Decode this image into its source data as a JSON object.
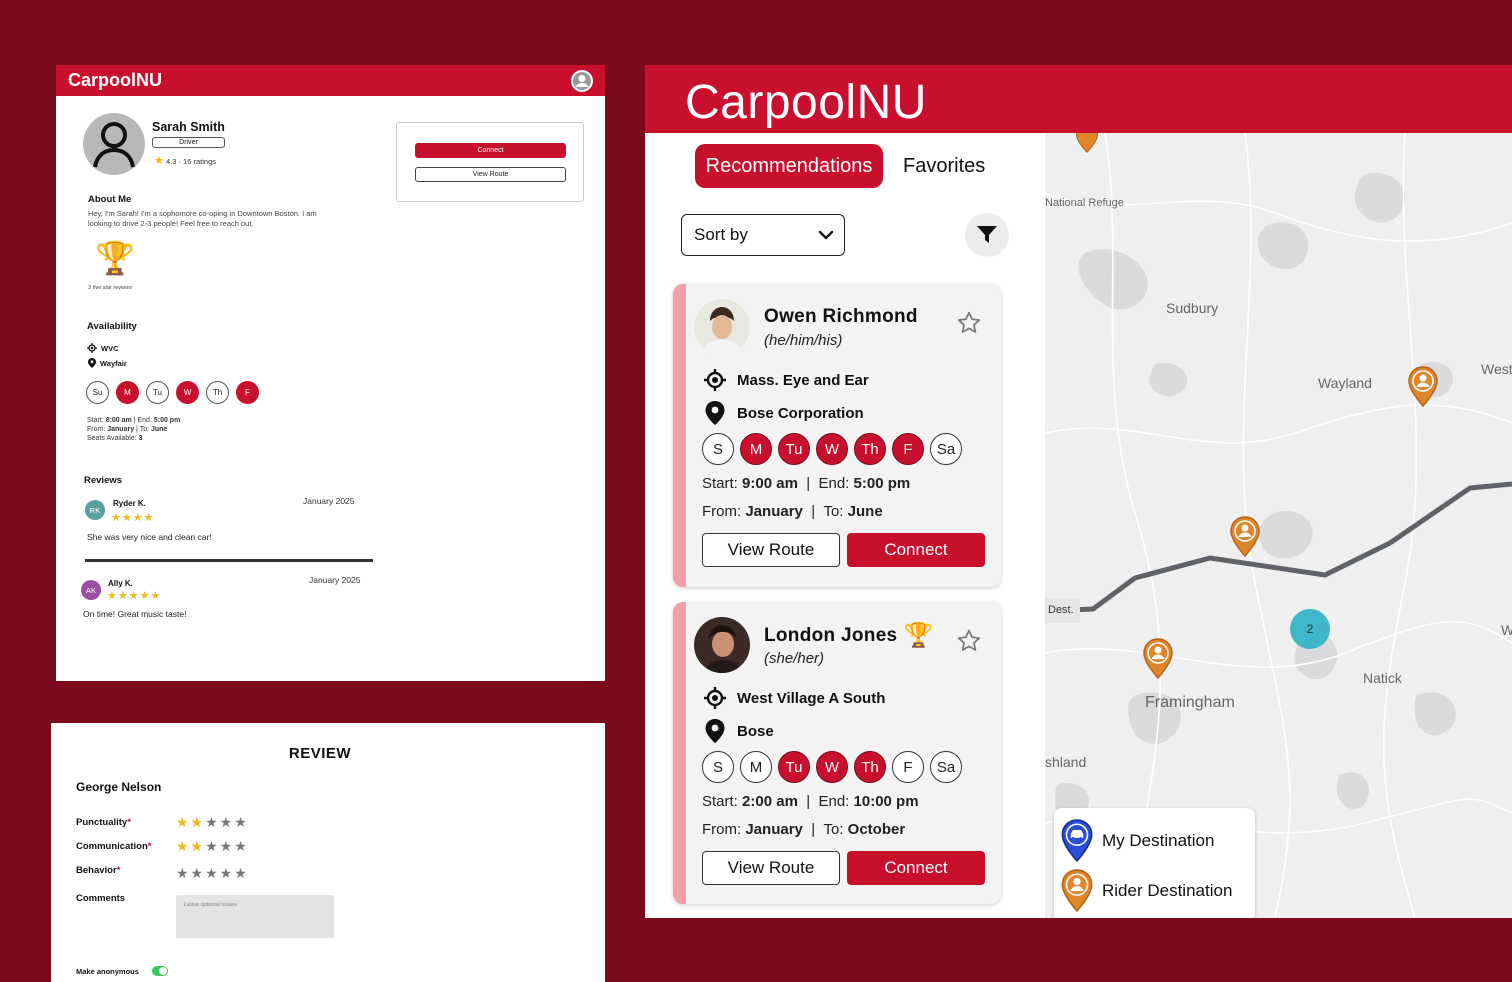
{
  "profile": {
    "brand": "CarpoolNU",
    "name": "Sarah Smith",
    "role": "Driver",
    "rating_text": "4.3 · 16 ratings",
    "connect_label": "Connect",
    "view_route_label": "View Route",
    "about_heading": "About Me",
    "about_text": "Hey, I'm Sarah! I'm a sophomore co-oping in Downtown Boston. I am looking to drive 2-3 people! Feel free to reach out.",
    "trophy_caption": "3 five star reviews",
    "availability_heading": "Availability",
    "start_location": "WVC",
    "end_location": "Wayfair",
    "days": [
      {
        "label": "Su",
        "on": false
      },
      {
        "label": "M",
        "on": true
      },
      {
        "label": "Tu",
        "on": false
      },
      {
        "label": "W",
        "on": true
      },
      {
        "label": "Th",
        "on": false
      },
      {
        "label": "F",
        "on": true
      }
    ],
    "start_label": "Start:",
    "start_time": "8:00 am",
    "end_label": "End:",
    "end_time": "5:00 pm",
    "from_label": "From:",
    "from_month": "January",
    "to_label": "To:",
    "to_month": "June",
    "seats_label": "Seats Available:",
    "seats": "3",
    "reviews_heading": "Reviews",
    "reviews": [
      {
        "initials": "RK",
        "name": "Ryder K.",
        "stars": 4,
        "date": "January 2025",
        "text": "She was very nice and clean car!",
        "color": "#5aa0a0"
      },
      {
        "initials": "AK",
        "name": "Ally K.",
        "stars": 5,
        "date": "January 2025",
        "text": "On time! Great music taste!",
        "color": "#9b4fa0"
      }
    ]
  },
  "review_form": {
    "title": "REVIEW",
    "person": "George Nelson",
    "criteria": [
      {
        "label": "Punctuality",
        "filled": 2
      },
      {
        "label": "Communication",
        "filled": 2
      },
      {
        "label": "Behavior",
        "filled": 0
      }
    ],
    "comments_label": "Comments",
    "comments_placeholder": "Leave optional review",
    "anonymous_label": "Make anonymous",
    "anonymous_on": true
  },
  "app": {
    "brand": "CarpoolNU",
    "tab_recommendations": "Recommendations",
    "tab_favorites": "Favorites",
    "sort_label": "Sort by",
    "cards": [
      {
        "name": "Owen Richmond",
        "pronouns": "(he/him/his)",
        "trophy": false,
        "start_location": "Mass. Eye and Ear",
        "end_location": "Bose Corporation",
        "days": [
          {
            "label": "S",
            "on": false
          },
          {
            "label": "M",
            "on": true
          },
          {
            "label": "Tu",
            "on": true
          },
          {
            "label": "W",
            "on": true
          },
          {
            "label": "Th",
            "on": true
          },
          {
            "label": "F",
            "on": true
          },
          {
            "label": "Sa",
            "on": false
          }
        ],
        "start_time": "9:00 am",
        "end_time": "5:00 pm",
        "from_month": "January",
        "to_month": "June",
        "view_route_label": "View Route",
        "connect_label": "Connect"
      },
      {
        "name": "London Jones",
        "pronouns": "(she/her)",
        "trophy": true,
        "start_location": "West Village A South",
        "end_location": "Bose",
        "days": [
          {
            "label": "S",
            "on": false
          },
          {
            "label": "M",
            "on": false
          },
          {
            "label": "Tu",
            "on": true
          },
          {
            "label": "W",
            "on": true
          },
          {
            "label": "Th",
            "on": true
          },
          {
            "label": "F",
            "on": false
          },
          {
            "label": "Sa",
            "on": false
          }
        ],
        "start_time": "2:00 am",
        "end_time": "10:00 pm",
        "from_month": "January",
        "to_month": "October",
        "view_route_label": "View Route",
        "connect_label": "Connect"
      }
    ],
    "labels": {
      "start": "Start:",
      "end": "End:",
      "from": "From:",
      "to": "To:"
    }
  },
  "map": {
    "places": [
      "Sudbury",
      "Wayland",
      "Framingham",
      "Natick",
      "National Refuge",
      "West",
      "shland",
      "W",
      "Dest."
    ],
    "cluster_count": "2",
    "legend": {
      "my_destination": "My Destination",
      "rider_destination": "Rider Destination"
    },
    "colors": {
      "rider_pin": "#e0862a",
      "my_pin": "#2a4fd6",
      "route": "#5f6266",
      "cluster": "#3fb6c9"
    }
  },
  "colors": {
    "accent": "#c8102e",
    "background": "#7c0a1c"
  }
}
